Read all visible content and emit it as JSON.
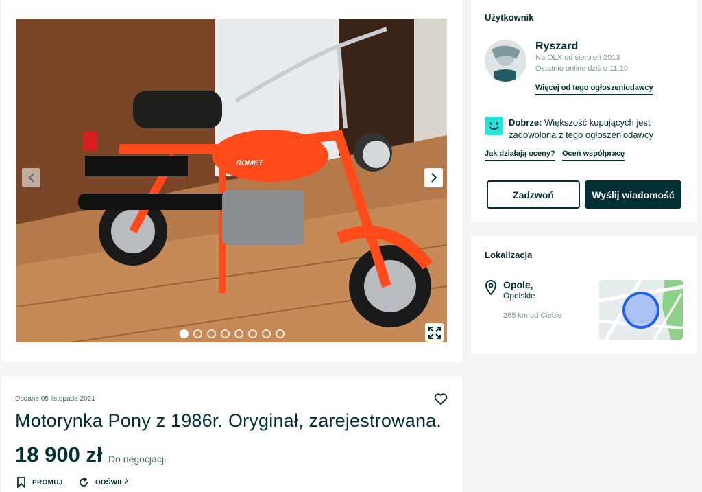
{
  "gallery": {
    "image_alt": "",
    "photo_count": 8,
    "active_index": 0,
    "brand_on_tank": "ROMET"
  },
  "ad": {
    "added": "Dodane 05 listopada 2021",
    "title": "Motorynka Pony z 1986r. Oryginał, zarejestrowana.",
    "price": "18 900 zł",
    "negotiation": "Do negocjacji",
    "actions": {
      "promote": "PROMUJ",
      "refresh": "ODŚWIEŻ"
    }
  },
  "user": {
    "section_title": "Użytkownik",
    "name": "Ryszard",
    "member_since": "Na OLX od sierpień 2013",
    "last_online": "Ostatnio online dziś o 11:10",
    "more_ads_link": "Więcej od tego ogłoszeniodawcy",
    "rating_label": "Dobrze:",
    "rating_text": " Większość kupujących jest zadowolona z tego ogłoszeniodawcy",
    "how_ratings_link": "Jak działają oceny?",
    "rate_link": "Oceń współpracę",
    "call_button": "Zadzwoń",
    "message_button": "Wyślij wiadomość"
  },
  "location": {
    "section_title": "Lokalizacja",
    "city": "Opole,",
    "region": "Opolskie",
    "distance": "285 km od Ciebie"
  },
  "colors": {
    "primary": "#002f34",
    "rating_accent": "#23e5db",
    "map_marker": "#3a77ff"
  }
}
